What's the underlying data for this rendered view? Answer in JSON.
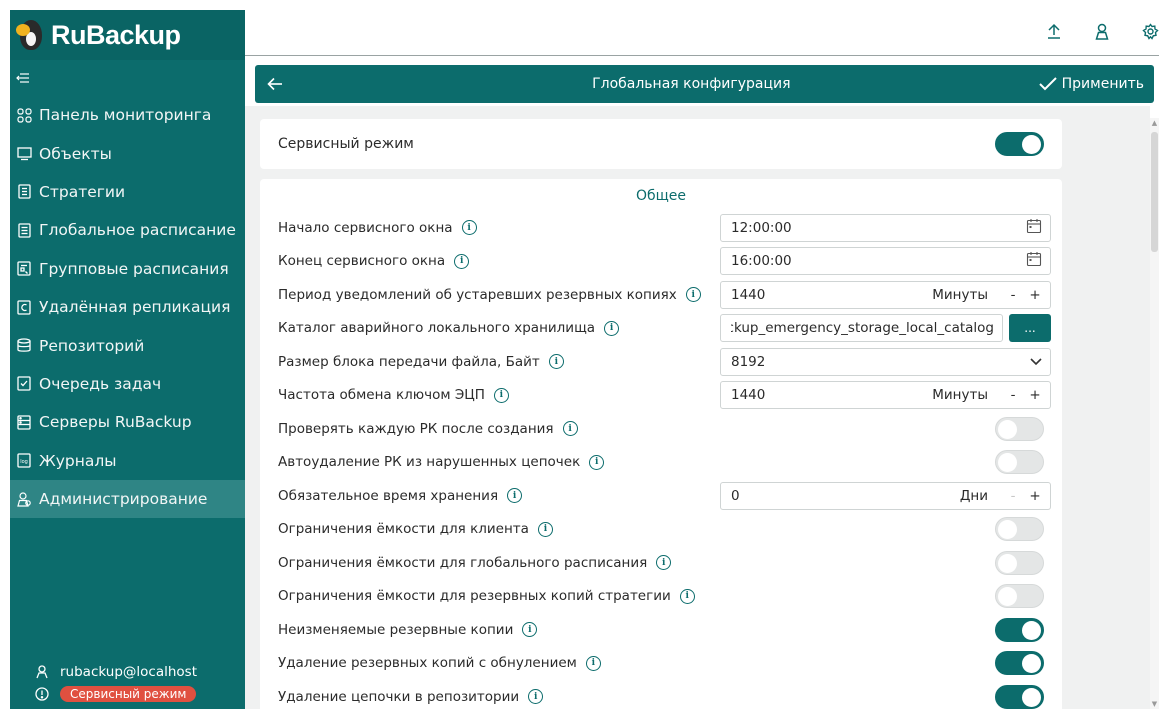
{
  "app": {
    "logo_text": "RuBackup"
  },
  "sidebar": {
    "items": [
      {
        "label": "Панель мониторинга",
        "icon": "grid-icon"
      },
      {
        "label": "Объекты",
        "icon": "monitor-icon"
      },
      {
        "label": "Стратегии",
        "icon": "document-icon"
      },
      {
        "label": "Глобальное расписание",
        "icon": "list-icon"
      },
      {
        "label": "Групповые расписания",
        "icon": "calendar-list-icon"
      },
      {
        "label": "Удалённая репликация",
        "icon": "replication-icon"
      },
      {
        "label": "Репозиторий",
        "icon": "database-icon"
      },
      {
        "label": "Очередь задач",
        "icon": "task-queue-icon"
      },
      {
        "label": "Серверы RuBackup",
        "icon": "server-icon"
      },
      {
        "label": "Журналы",
        "icon": "log-icon"
      },
      {
        "label": "Администрирование",
        "icon": "admin-users-icon",
        "active": true
      }
    ],
    "user": "rubackup@localhost",
    "status_badge": "Сервисный режим"
  },
  "header": {
    "title": "Глобальная конфигурация",
    "apply_label": "Применить"
  },
  "service_mode": {
    "label": "Сервисный режим",
    "enabled": true
  },
  "general": {
    "section_title": "Общее",
    "rows": [
      {
        "label": "Начало сервисного окна",
        "type": "time",
        "value": "12:00:00"
      },
      {
        "label": "Конец сервисного окна",
        "type": "time",
        "value": "16:00:00"
      },
      {
        "label": "Период уведомлений об устаревших резервных копиях",
        "type": "number",
        "value": "1440",
        "unit": "Минуты"
      },
      {
        "label": "Каталог аварийного локального хранилища",
        "type": "path",
        "value": "rubackup_emergency_storage_local_catalog",
        "button": "..."
      },
      {
        "label": "Размер блока передачи файла, Байт",
        "type": "select",
        "value": "8192"
      },
      {
        "label": "Частота обмена ключом ЭЦП",
        "type": "number",
        "value": "1440",
        "unit": "Минуты"
      },
      {
        "label": "Проверять каждую РК после создания",
        "type": "toggle",
        "enabled": false
      },
      {
        "label": "Автоудаление РК из нарушенных цепочек",
        "type": "toggle",
        "enabled": false
      },
      {
        "label": "Обязательное время хранения",
        "type": "number",
        "value": "0",
        "unit": "Дни"
      },
      {
        "label": "Ограничения ёмкости для клиента",
        "type": "toggle",
        "enabled": false
      },
      {
        "label": "Ограничения ёмкости для глобального расписания",
        "type": "toggle",
        "enabled": false
      },
      {
        "label": "Ограничения ёмкости для резервных копий стратегии",
        "type": "toggle",
        "enabled": false
      },
      {
        "label": "Неизменяемые резервные копии",
        "type": "toggle",
        "enabled": true
      },
      {
        "label": "Удаление резервных копий с обнулением",
        "type": "toggle",
        "enabled": true
      },
      {
        "label": "Удаление цепочки в репозитории",
        "type": "toggle",
        "enabled": true
      }
    ]
  },
  "colors": {
    "primary": "#0c6c6c",
    "badge": "#e05040",
    "background": "#f0f1f1"
  }
}
